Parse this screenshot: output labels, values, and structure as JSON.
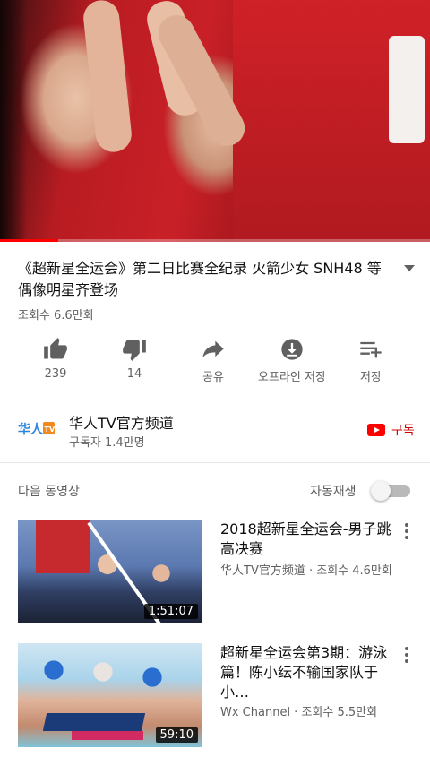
{
  "video": {
    "title": "《超新星全运会》第二日比赛全纪录 火箭少女 SNH48 等偶像明星齐登场",
    "views": "조회수 6.6만회",
    "progress_percent": 13.5
  },
  "actions": [
    {
      "icon": "thumbs-up-icon",
      "label": "239"
    },
    {
      "icon": "thumbs-down-icon",
      "label": "14"
    },
    {
      "icon": "share-icon",
      "label": "공유"
    },
    {
      "icon": "download-icon",
      "label": "오프라인 저장"
    },
    {
      "icon": "add-to-playlist-icon",
      "label": "저장"
    }
  ],
  "channel": {
    "name": "华人TV官方频道",
    "subscribers": "구독자 1.4만명",
    "logo_text_a": "华人",
    "logo_text_b": "TV",
    "subscribe_label": "구독",
    "colors": {
      "subscribe": "#cc0000",
      "logo_blue": "#2e86de",
      "logo_orange": "#f08a1d"
    }
  },
  "up_next": {
    "label": "다음 동영상",
    "autoplay_label": "자동재생",
    "autoplay_on": false
  },
  "videos": [
    {
      "title": "2018超新星全运会-男子跳高决赛",
      "meta": "华人TV官方频道 · 조회수 4.6만회",
      "duration": "1:51:07"
    },
    {
      "title": "超新星全运会第3期：游泳篇！陈小纭不输国家队于小…",
      "meta": "Wx Channel · 조회수 5.5만회",
      "duration": "59:10"
    }
  ]
}
